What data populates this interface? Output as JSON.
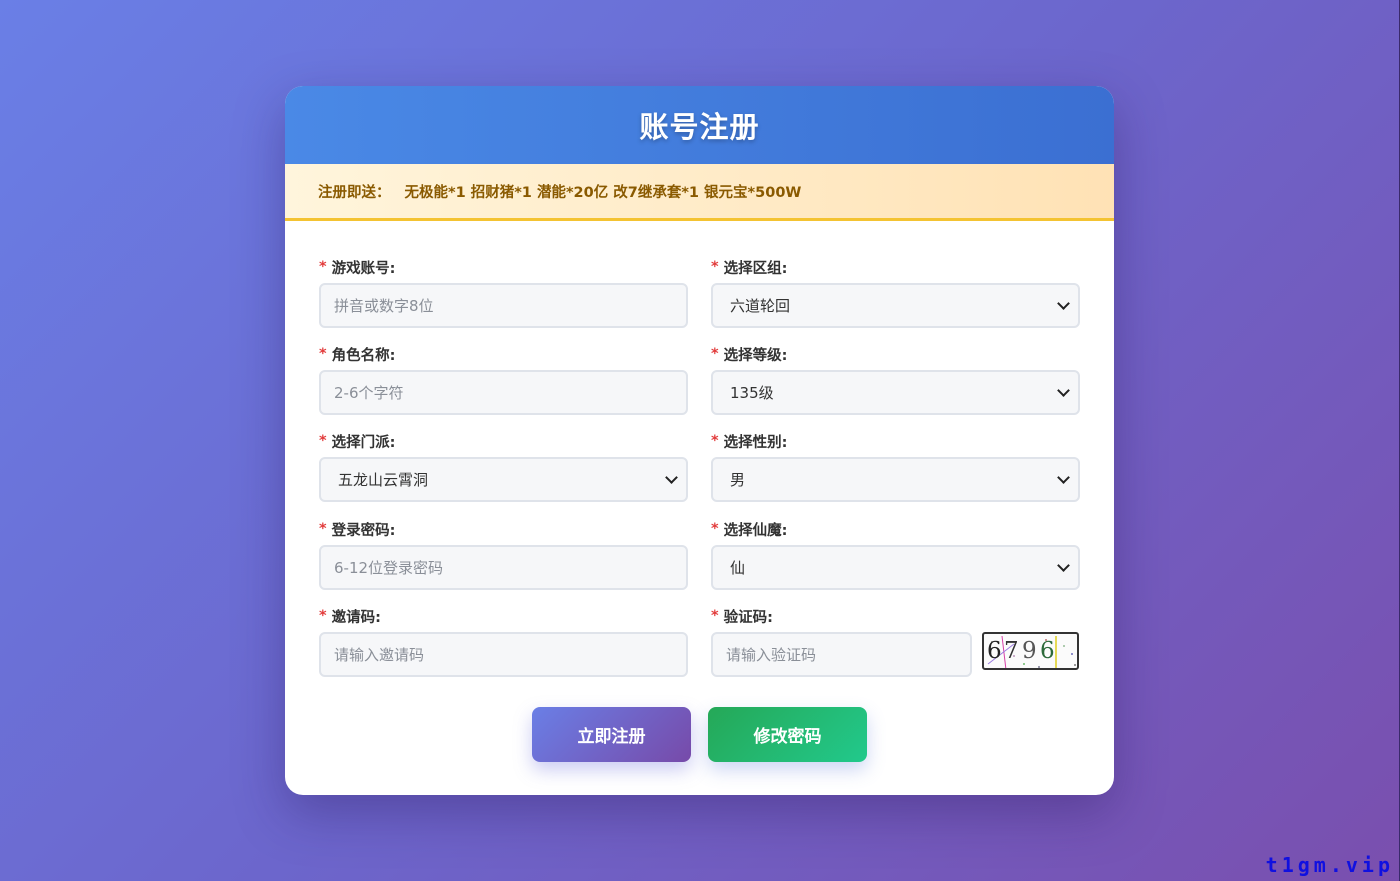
{
  "header": {
    "title": "账号注册"
  },
  "promo": {
    "label": "注册即送：",
    "text": "无极能*1 招财猪*1 潜能*20亿 改7继承套*1 银元宝*500W"
  },
  "required_mark": "*",
  "fields": {
    "account": {
      "label": "游戏账号:",
      "placeholder": "拼音或数字8位"
    },
    "zone": {
      "label": "选择区组:",
      "value": "六道轮回"
    },
    "role": {
      "label": "角色名称:",
      "placeholder": "2-6个字符"
    },
    "level": {
      "label": "选择等级:",
      "value": "135级"
    },
    "sect": {
      "label": "选择门派:",
      "value": "五龙山云霄洞"
    },
    "gender": {
      "label": "选择性别:",
      "value": "男"
    },
    "password": {
      "label": "登录密码:",
      "placeholder": "6-12位登录密码"
    },
    "faction": {
      "label": "选择仙魔:",
      "value": "仙"
    },
    "invite": {
      "label": "邀请码:",
      "placeholder": "请输入邀请码"
    },
    "captcha": {
      "label": "验证码:",
      "placeholder": "请输入验证码",
      "image_text": [
        "6",
        "7",
        "9",
        "6"
      ]
    }
  },
  "buttons": {
    "register": "立即注册",
    "change_password": "修改密码"
  },
  "watermark": "t1gm.vip",
  "colors": {
    "header_blue": "#4a89e6",
    "promo_text": "#8a5a00",
    "required": "#e23b3b",
    "register_btn": "#6a7fe6",
    "password_btn": "#25a857",
    "watermark": "#1010e0"
  }
}
